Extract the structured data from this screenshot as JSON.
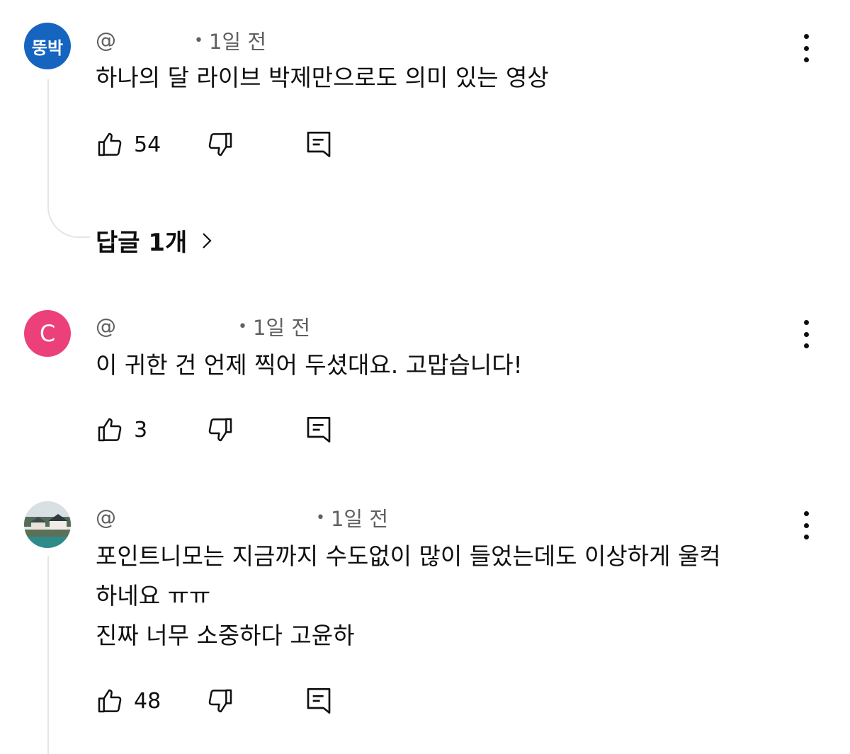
{
  "comments": [
    {
      "avatar_text": "뚱박",
      "avatar_color": "#1565c0",
      "handle": "@",
      "time": "1일 전",
      "text": "하나의 달 라이브 박제만으로도 의미 있는 영상",
      "likes": "54",
      "replies_label": "답글 1개"
    },
    {
      "avatar_text": "C",
      "avatar_color": "#ec407a",
      "handle": "@",
      "time": "1일 전",
      "text": "이 귀한 건 언제 찍어 두셨대요. 고맙습니다!",
      "likes": "3"
    },
    {
      "avatar_text": "",
      "handle": "@",
      "time": "1일 전",
      "text": "포인트니모는 지금까지 수도없이 많이 들었는데도 이상하게 울컥\n하네요 ㅠㅠ\n진짜 너무 소중하다 고윤하",
      "likes": "48"
    }
  ],
  "icons": {
    "like": "thumbs-up-icon",
    "dislike": "thumbs-down-icon",
    "reply": "reply-icon",
    "menu": "more-vert-icon",
    "chevron": "chevron-right-icon"
  }
}
